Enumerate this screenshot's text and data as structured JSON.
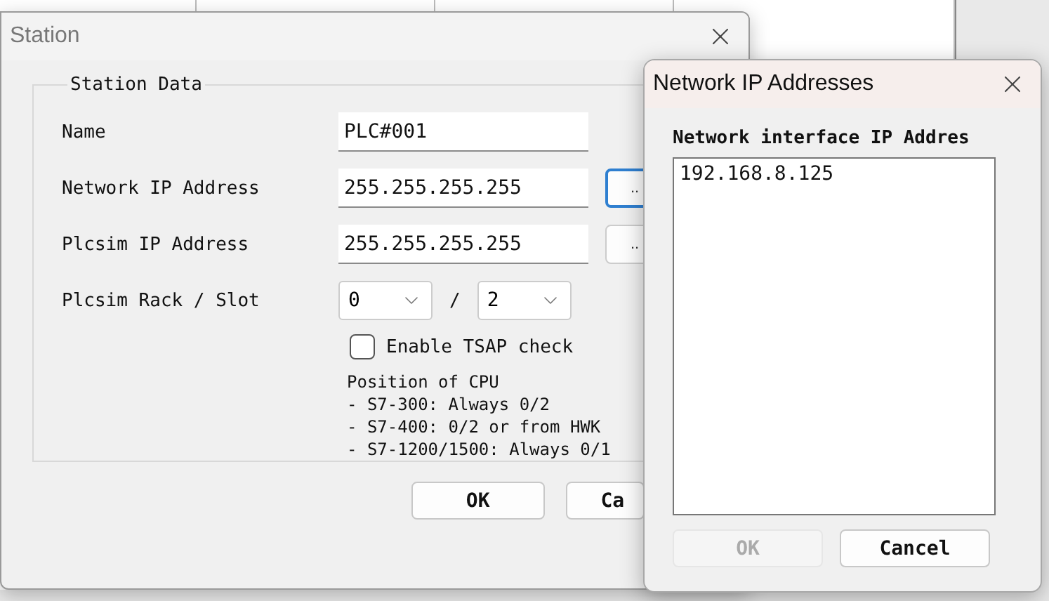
{
  "station": {
    "title": "Station",
    "group": "Station Data",
    "fields": [
      {
        "label": "Name",
        "value": "PLC#001"
      },
      {
        "label": "Network IP Address",
        "value": "255.255.255.255",
        "browse": "..",
        "focused": true
      },
      {
        "label": "Plcsim IP Address",
        "value": "255.255.255.255",
        "browse": "..",
        "focused": false
      }
    ],
    "rack_slot": {
      "label": "Plcsim Rack / Slot",
      "rack": "0",
      "separator": "/",
      "slot": "2"
    },
    "tsap_check": {
      "label": "Enable TSAP check",
      "checked": false
    },
    "help_lines": [
      "Position of CPU",
      "- S7-300: Always 0/2",
      "- S7-400: 0/2 or from HWK",
      "- S7-1200/1500: Always 0/1"
    ],
    "buttons": [
      {
        "label": "OK",
        "disabled": false
      },
      {
        "label": "Ca",
        "disabled": false
      }
    ]
  },
  "addresses": {
    "title": "Network IP Addresses",
    "list_label": "Network interface IP Addres",
    "items": [
      {
        "label": "192.168.8.125",
        "selected": false
      }
    ],
    "buttons": [
      {
        "label": "OK",
        "disabled": true
      },
      {
        "label": "Cancel",
        "disabled": false
      }
    ]
  }
}
